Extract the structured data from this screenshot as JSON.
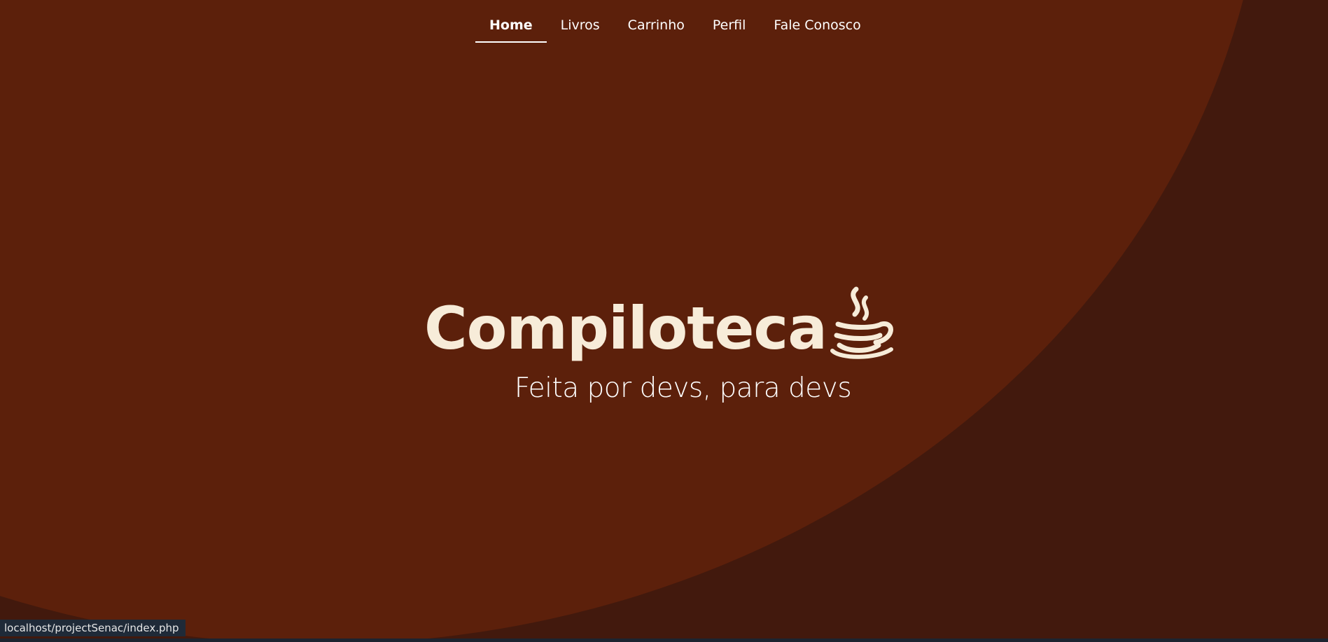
{
  "nav": {
    "items": [
      {
        "label": "Home",
        "active": true
      },
      {
        "label": "Livros",
        "active": false
      },
      {
        "label": "Carrinho",
        "active": false
      },
      {
        "label": "Perfil",
        "active": false
      },
      {
        "label": "Fale Conosco",
        "active": false
      }
    ]
  },
  "hero": {
    "logo_text": "Compiloteca",
    "logo_icon": "java-coffee-cup-icon",
    "tagline": "Feita por devs, para devs"
  },
  "status_bar": {
    "url": "localhost/projectSenac/index.php"
  },
  "colors": {
    "background": "#5c200b",
    "background_dark": "#42190d",
    "logo": "#f7ecd9",
    "text": "#ffffff",
    "status_bg": "#1f2a38"
  }
}
